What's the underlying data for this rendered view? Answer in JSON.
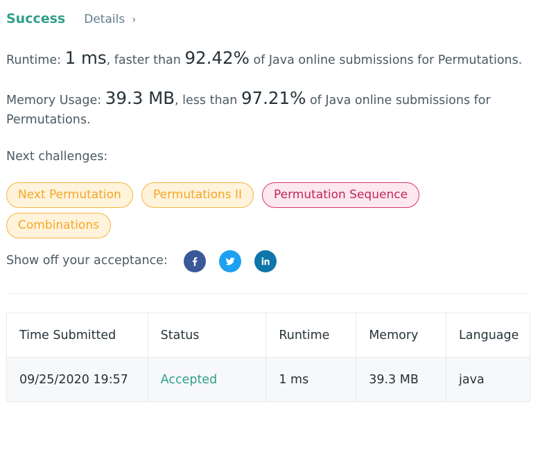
{
  "result": {
    "status": "Success",
    "details_label": "Details",
    "details_chevron": "›"
  },
  "runtime": {
    "label": "Runtime:",
    "value": "1 ms",
    "middle": ", faster than",
    "percent": "92.42%",
    "suffix": "of Java online submissions for Permutations."
  },
  "memory": {
    "label": "Memory Usage:",
    "value": "39.3 MB",
    "middle": ", less than",
    "percent": "97.21%",
    "suffix": "of Java online submissions for Permutations."
  },
  "next_challenges": {
    "title": "Next challenges:",
    "items": [
      {
        "label": "Next Permutation",
        "difficulty": "medium"
      },
      {
        "label": "Permutations II",
        "difficulty": "medium"
      },
      {
        "label": "Permutation Sequence",
        "difficulty": "hard"
      },
      {
        "label": "Combinations",
        "difficulty": "medium"
      }
    ]
  },
  "share": {
    "label": "Show off your acceptance:",
    "networks": [
      {
        "name": "facebook-icon",
        "color": "#3b5998"
      },
      {
        "name": "twitter-icon",
        "color": "#1da1f2"
      },
      {
        "name": "linkedin-icon",
        "color": "#0e76a8"
      }
    ]
  },
  "submissions": {
    "headers": [
      "Time Submitted",
      "Status",
      "Runtime",
      "Memory",
      "Language"
    ],
    "rows": [
      [
        "09/25/2020 19:57",
        "Accepted",
        "1 ms",
        "39.3 MB",
        "java"
      ]
    ]
  },
  "colors": {
    "accepted": "#2e9e8a",
    "medium_tag": "#f5a623",
    "hard_tag": "#c2255c"
  }
}
